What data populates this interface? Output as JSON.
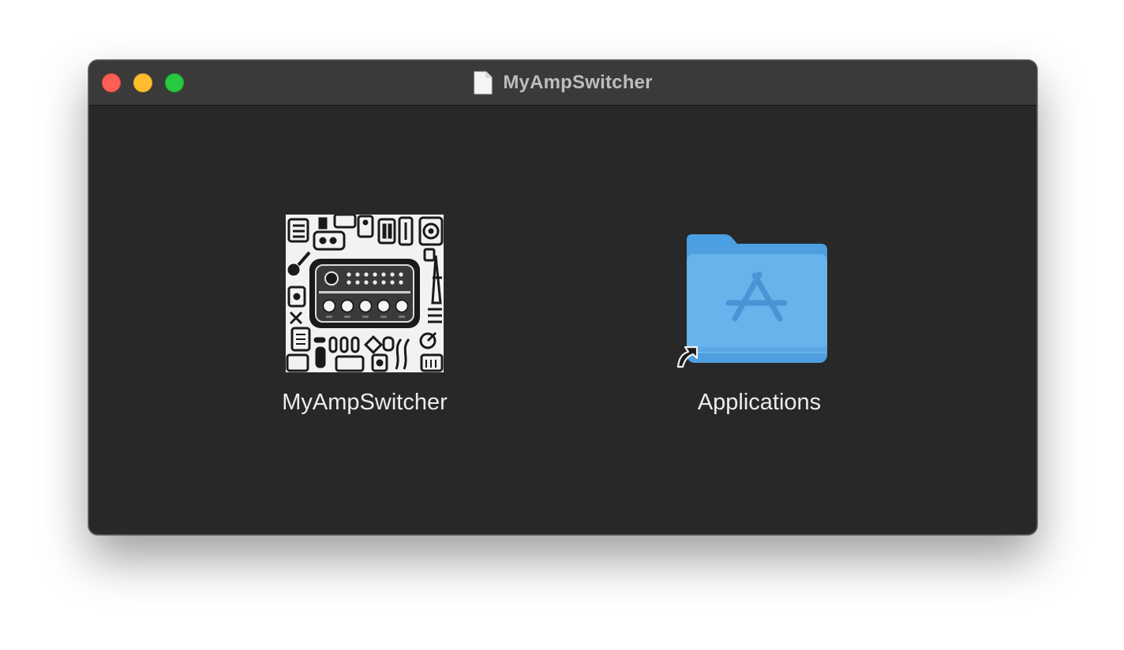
{
  "window": {
    "title": "MyAmpSwitcher",
    "title_icon": "document-icon",
    "controls": [
      "close",
      "minimize",
      "zoom"
    ]
  },
  "items": [
    {
      "label": "MyAmpSwitcher",
      "icon": "amp-switcher-app-icon"
    },
    {
      "label": "Applications",
      "icon": "applications-folder-icon",
      "alias": true
    }
  ],
  "colors": {
    "window_bg": "#282828",
    "titlebar_bg": "#3a3a3a",
    "close": "#ff5f57",
    "minimize": "#febc2e",
    "zoom": "#28c840",
    "folder_blue": "#64b2ea"
  }
}
